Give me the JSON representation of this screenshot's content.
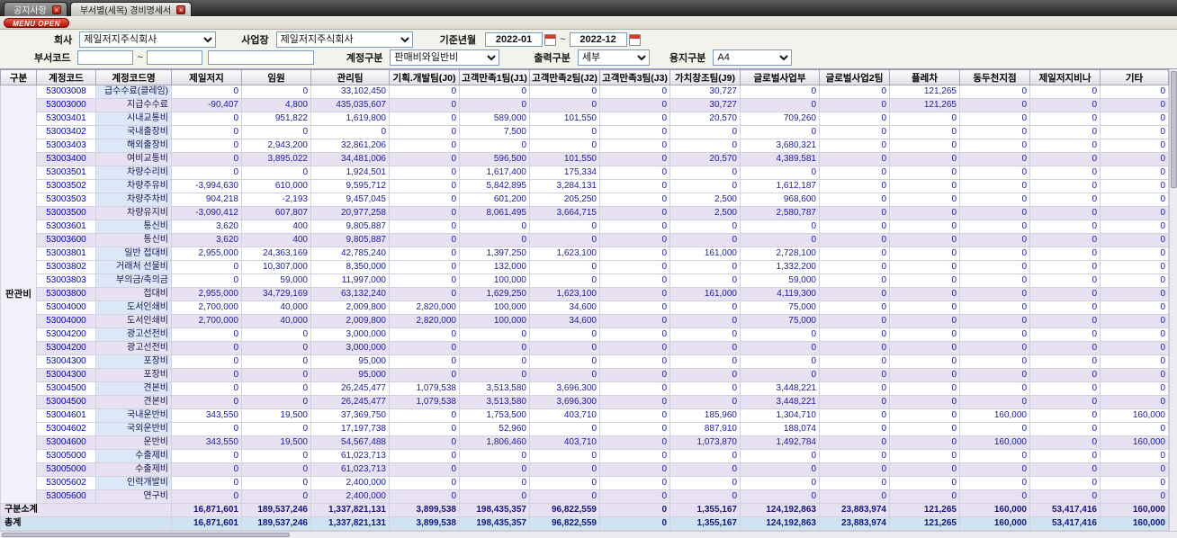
{
  "tabs": [
    {
      "label": "공지사항"
    },
    {
      "label": "부서별(세목) 경비명세서"
    }
  ],
  "menu_open_label": "MENU OPEN",
  "filters": {
    "company_label": "회사",
    "company_value": "제일저지주식회사",
    "workplace_label": "사업장",
    "workplace_value": "제일저지주식회사",
    "period_label": "기준년월",
    "period_from": "2022-01",
    "period_to": "2022-12",
    "tilde": "~",
    "dept_code_label": "부서코드",
    "account_group_label": "계정구분",
    "account_group_value": "판매비와일반비",
    "output_label": "출력구분",
    "output_value": "세부",
    "paper_label": "용지구분",
    "paper_value": "A4"
  },
  "table": {
    "group_label": "판관비",
    "columns": [
      "구분",
      "계정코드",
      "계정코드명",
      "제일저지",
      "임원",
      "관리팀",
      "기획.개발팀(J0)",
      "고객만족1팀(J1)",
      "고객만족2팀(J2)",
      "고객만족3팀(J3)",
      "가치창조팀(J9)",
      "글로벌사업부",
      "글로벌사업2팀",
      "플레차",
      "동두천지점",
      "제일저지비나",
      "기타"
    ],
    "rows": [
      {
        "code": "53003008",
        "name": "급수수료(클레임)",
        "summary": false,
        "values": [
          "0",
          "0",
          "33,102,450",
          "0",
          "0",
          "0",
          "0",
          "30,727",
          "0",
          "0",
          "121,265",
          "0",
          "0",
          "0"
        ]
      },
      {
        "code": "53003000",
        "name": "지급수수료",
        "summary": true,
        "values": [
          "-90,407",
          "4,800",
          "435,035,607",
          "0",
          "0",
          "0",
          "0",
          "30,727",
          "0",
          "0",
          "121,265",
          "0",
          "0",
          "0"
        ]
      },
      {
        "code": "53003401",
        "name": "시내교통비",
        "summary": false,
        "values": [
          "0",
          "951,822",
          "1,619,800",
          "0",
          "589,000",
          "101,550",
          "0",
          "20,570",
          "709,260",
          "0",
          "0",
          "0",
          "0",
          "0"
        ]
      },
      {
        "code": "53003402",
        "name": "국내출장비",
        "summary": false,
        "values": [
          "0",
          "0",
          "0",
          "0",
          "7,500",
          "0",
          "0",
          "0",
          "0",
          "0",
          "0",
          "0",
          "0",
          "0"
        ]
      },
      {
        "code": "53003403",
        "name": "해외출장비",
        "summary": false,
        "values": [
          "0",
          "2,943,200",
          "32,861,206",
          "0",
          "0",
          "0",
          "0",
          "0",
          "3,680,321",
          "0",
          "0",
          "0",
          "0",
          "0"
        ]
      },
      {
        "code": "53003400",
        "name": "여비교통비",
        "summary": true,
        "values": [
          "0",
          "3,895,022",
          "34,481,006",
          "0",
          "596,500",
          "101,550",
          "0",
          "20,570",
          "4,389,581",
          "0",
          "0",
          "0",
          "0",
          "0"
        ]
      },
      {
        "code": "53003501",
        "name": "차량수리비",
        "summary": false,
        "values": [
          "0",
          "0",
          "1,924,501",
          "0",
          "1,617,400",
          "175,334",
          "0",
          "0",
          "0",
          "0",
          "0",
          "0",
          "0",
          "0"
        ]
      },
      {
        "code": "53003502",
        "name": "차량주유비",
        "summary": false,
        "values": [
          "-3,994,630",
          "610,000",
          "9,595,712",
          "0",
          "5,842,895",
          "3,284,131",
          "0",
          "0",
          "1,612,187",
          "0",
          "0",
          "0",
          "0",
          "0"
        ]
      },
      {
        "code": "53003503",
        "name": "차량주차비",
        "summary": false,
        "values": [
          "904,218",
          "-2,193",
          "9,457,045",
          "0",
          "601,200",
          "205,250",
          "0",
          "2,500",
          "968,600",
          "0",
          "0",
          "0",
          "0",
          "0"
        ]
      },
      {
        "code": "53003500",
        "name": "차량유지비",
        "summary": true,
        "values": [
          "-3,090,412",
          "607,807",
          "20,977,258",
          "0",
          "8,061,495",
          "3,664,715",
          "0",
          "2,500",
          "2,580,787",
          "0",
          "0",
          "0",
          "0",
          "0"
        ]
      },
      {
        "code": "53003601",
        "name": "통신비",
        "summary": false,
        "values": [
          "3,620",
          "400",
          "9,805,887",
          "0",
          "0",
          "0",
          "0",
          "0",
          "0",
          "0",
          "0",
          "0",
          "0",
          "0"
        ]
      },
      {
        "code": "53003600",
        "name": "통신비",
        "summary": true,
        "values": [
          "3,620",
          "400",
          "9,805,887",
          "0",
          "0",
          "0",
          "0",
          "0",
          "0",
          "0",
          "0",
          "0",
          "0",
          "0"
        ]
      },
      {
        "code": "53003801",
        "name": "일반 접대비",
        "summary": false,
        "values": [
          "2,955,000",
          "24,363,169",
          "42,785,240",
          "0",
          "1,397,250",
          "1,623,100",
          "0",
          "161,000",
          "2,728,100",
          "0",
          "0",
          "0",
          "0",
          "0"
        ]
      },
      {
        "code": "53003802",
        "name": "거래처 선물비",
        "summary": false,
        "values": [
          "0",
          "10,307,000",
          "8,350,000",
          "0",
          "132,000",
          "0",
          "0",
          "0",
          "1,332,200",
          "0",
          "0",
          "0",
          "0",
          "0"
        ]
      },
      {
        "code": "53003803",
        "name": "부의금/축의금",
        "summary": false,
        "values": [
          "0",
          "59,000",
          "11,997,000",
          "0",
          "100,000",
          "0",
          "0",
          "0",
          "59,000",
          "0",
          "0",
          "0",
          "0",
          "0"
        ]
      },
      {
        "code": "53003800",
        "name": "접대비",
        "summary": true,
        "values": [
          "2,955,000",
          "34,729,169",
          "63,132,240",
          "0",
          "1,629,250",
          "1,623,100",
          "0",
          "161,000",
          "4,119,300",
          "0",
          "0",
          "0",
          "0",
          "0"
        ]
      },
      {
        "code": "53004000",
        "name": "도서인쇄비",
        "summary": false,
        "values": [
          "2,700,000",
          "40,000",
          "2,009,800",
          "2,820,000",
          "100,000",
          "34,600",
          "0",
          "0",
          "75,000",
          "0",
          "0",
          "0",
          "0",
          "0"
        ]
      },
      {
        "code": "53004000",
        "name": "도서인쇄비",
        "summary": true,
        "values": [
          "2,700,000",
          "40,000",
          "2,009,800",
          "2,820,000",
          "100,000",
          "34,600",
          "0",
          "0",
          "75,000",
          "0",
          "0",
          "0",
          "0",
          "0"
        ]
      },
      {
        "code": "53004200",
        "name": "광고선전비",
        "summary": false,
        "values": [
          "0",
          "0",
          "3,000,000",
          "0",
          "0",
          "0",
          "0",
          "0",
          "0",
          "0",
          "0",
          "0",
          "0",
          "0"
        ]
      },
      {
        "code": "53004200",
        "name": "광고선전비",
        "summary": true,
        "values": [
          "0",
          "0",
          "3,000,000",
          "0",
          "0",
          "0",
          "0",
          "0",
          "0",
          "0",
          "0",
          "0",
          "0",
          "0"
        ]
      },
      {
        "code": "53004300",
        "name": "포장비",
        "summary": false,
        "values": [
          "0",
          "0",
          "95,000",
          "0",
          "0",
          "0",
          "0",
          "0",
          "0",
          "0",
          "0",
          "0",
          "0",
          "0"
        ]
      },
      {
        "code": "53004300",
        "name": "포장비",
        "summary": true,
        "values": [
          "0",
          "0",
          "95,000",
          "0",
          "0",
          "0",
          "0",
          "0",
          "0",
          "0",
          "0",
          "0",
          "0",
          "0"
        ]
      },
      {
        "code": "53004500",
        "name": "견본비",
        "summary": false,
        "values": [
          "0",
          "0",
          "26,245,477",
          "1,079,538",
          "3,513,580",
          "3,696,300",
          "0",
          "0",
          "3,448,221",
          "0",
          "0",
          "0",
          "0",
          "0"
        ]
      },
      {
        "code": "53004500",
        "name": "견본비",
        "summary": true,
        "values": [
          "0",
          "0",
          "26,245,477",
          "1,079,538",
          "3,513,580",
          "3,696,300",
          "0",
          "0",
          "3,448,221",
          "0",
          "0",
          "0",
          "0",
          "0"
        ]
      },
      {
        "code": "53004601",
        "name": "국내운반비",
        "summary": false,
        "values": [
          "343,550",
          "19,500",
          "37,369,750",
          "0",
          "1,753,500",
          "403,710",
          "0",
          "185,960",
          "1,304,710",
          "0",
          "0",
          "160,000",
          "0",
          "160,000"
        ]
      },
      {
        "code": "53004602",
        "name": "국외운반비",
        "summary": false,
        "values": [
          "0",
          "0",
          "17,197,738",
          "0",
          "52,960",
          "0",
          "0",
          "887,910",
          "188,074",
          "0",
          "0",
          "0",
          "0",
          "0"
        ]
      },
      {
        "code": "53004600",
        "name": "운반비",
        "summary": true,
        "values": [
          "343,550",
          "19,500",
          "54,567,488",
          "0",
          "1,806,460",
          "403,710",
          "0",
          "1,073,870",
          "1,492,784",
          "0",
          "0",
          "160,000",
          "0",
          "160,000"
        ]
      },
      {
        "code": "53005000",
        "name": "수출제비",
        "summary": false,
        "values": [
          "0",
          "0",
          "61,023,713",
          "0",
          "0",
          "0",
          "0",
          "0",
          "0",
          "0",
          "0",
          "0",
          "0",
          "0"
        ]
      },
      {
        "code": "53005000",
        "name": "수출제비",
        "summary": true,
        "values": [
          "0",
          "0",
          "61,023,713",
          "0",
          "0",
          "0",
          "0",
          "0",
          "0",
          "0",
          "0",
          "0",
          "0",
          "0"
        ]
      },
      {
        "code": "53005602",
        "name": "인력개발비",
        "summary": false,
        "values": [
          "0",
          "0",
          "2,400,000",
          "0",
          "0",
          "0",
          "0",
          "0",
          "0",
          "0",
          "0",
          "0",
          "0",
          "0"
        ]
      },
      {
        "code": "53005600",
        "name": "연구비",
        "summary": true,
        "values": [
          "0",
          "0",
          "2,400,000",
          "0",
          "0",
          "0",
          "0",
          "0",
          "0",
          "0",
          "0",
          "0",
          "0",
          "0"
        ]
      }
    ],
    "footer": [
      {
        "label": "구분소계",
        "values": [
          "16,871,601",
          "189,537,246",
          "1,337,821,131",
          "3,899,538",
          "198,435,357",
          "96,822,559",
          "0",
          "1,355,167",
          "124,192,863",
          "23,883,974",
          "121,265",
          "160,000",
          "53,417,416",
          "160,000"
        ]
      },
      {
        "label": "총계",
        "values": [
          "16,871,601",
          "189,537,246",
          "1,337,821,131",
          "3,899,538",
          "198,435,357",
          "96,822,559",
          "0",
          "1,355,167",
          "124,192,863",
          "23,883,974",
          "121,265",
          "160,000",
          "53,417,416",
          "160,000"
        ]
      }
    ]
  }
}
